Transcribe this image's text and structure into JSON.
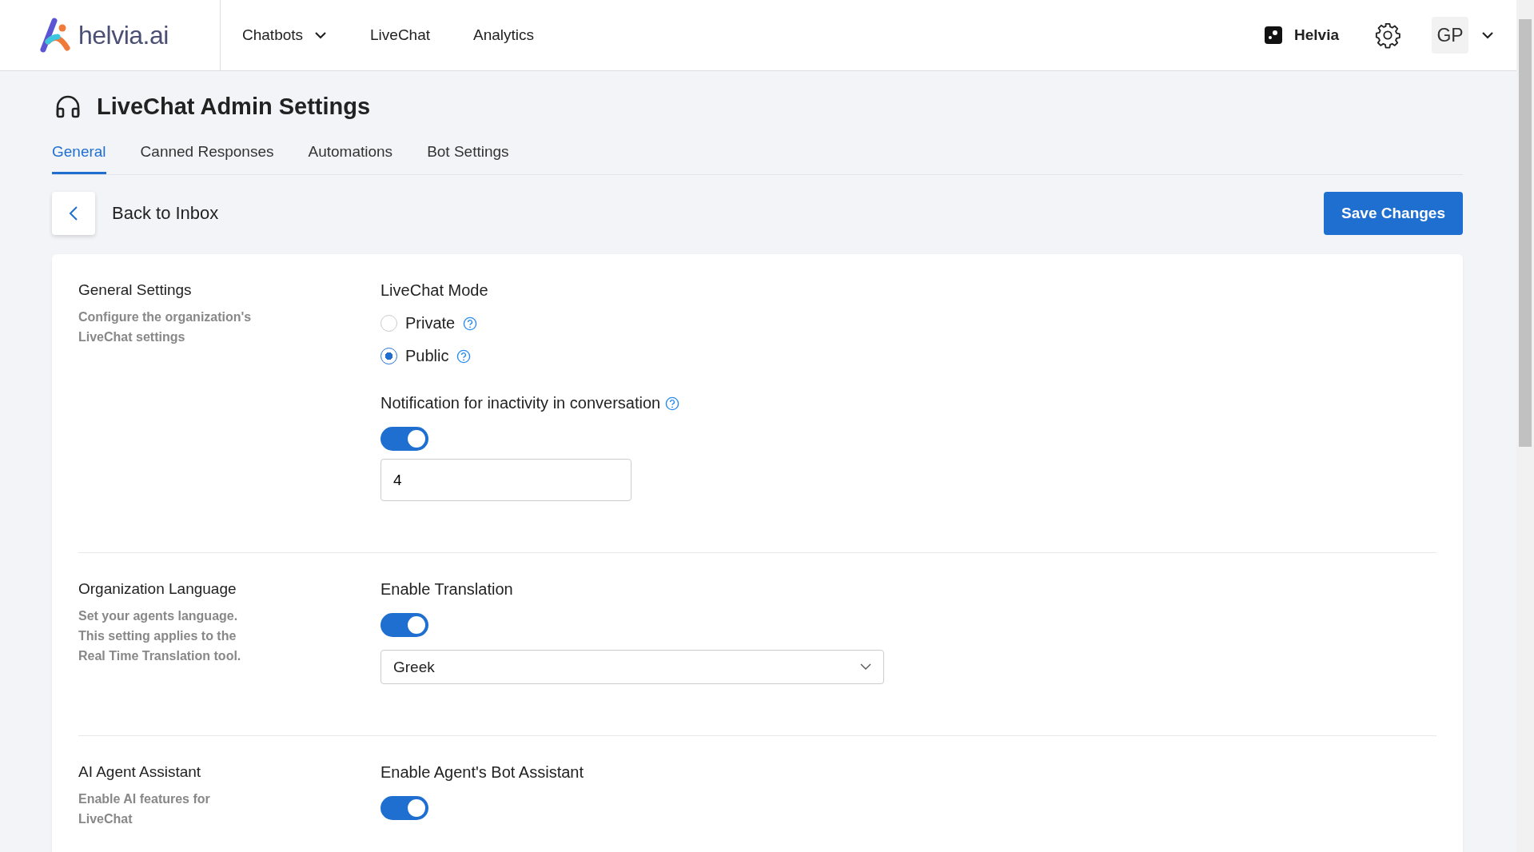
{
  "header": {
    "logo_text": "helvia.ai",
    "nav": [
      {
        "label": "Chatbots",
        "has_menu": true
      },
      {
        "label": "LiveChat",
        "has_menu": false
      },
      {
        "label": "Analytics",
        "has_menu": false
      }
    ],
    "workspace": "Helvia",
    "avatar": "GP"
  },
  "page": {
    "title": "LiveChat Admin Settings",
    "tabs": [
      {
        "label": "General",
        "selected": true
      },
      {
        "label": "Canned Responses",
        "selected": false
      },
      {
        "label": "Automations",
        "selected": false
      },
      {
        "label": "Bot Settings",
        "selected": false
      }
    ],
    "back_label": "Back to Inbox",
    "save_label": "Save Changes"
  },
  "sections": [
    {
      "title": "General Settings",
      "description": "Configure the organization's LiveChat settings",
      "fields": [
        {
          "kind": "radio_group",
          "label": "LiveChat Mode",
          "options": [
            {
              "label": "Private",
              "selected": false
            },
            {
              "label": "Public",
              "selected": true
            }
          ]
        },
        {
          "kind": "toggle",
          "label": "Notification for inactivity in conversation",
          "help": true,
          "on": true
        },
        {
          "kind": "input",
          "value": "4"
        }
      ]
    },
    {
      "title": "Organization Language",
      "description": "Set your agents language. This setting applies to the Real Time Translation tool.",
      "fields": [
        {
          "kind": "toggle",
          "label": "Enable Translation",
          "help": false,
          "on": true
        },
        {
          "kind": "select",
          "value": "Greek"
        }
      ]
    },
    {
      "title": "AI Agent Assistant",
      "description": "Enable AI features for LiveChat",
      "fields": [
        {
          "kind": "toggle",
          "label": "Enable Agent's Bot Assistant",
          "help": false,
          "on": true
        }
      ]
    }
  ]
}
